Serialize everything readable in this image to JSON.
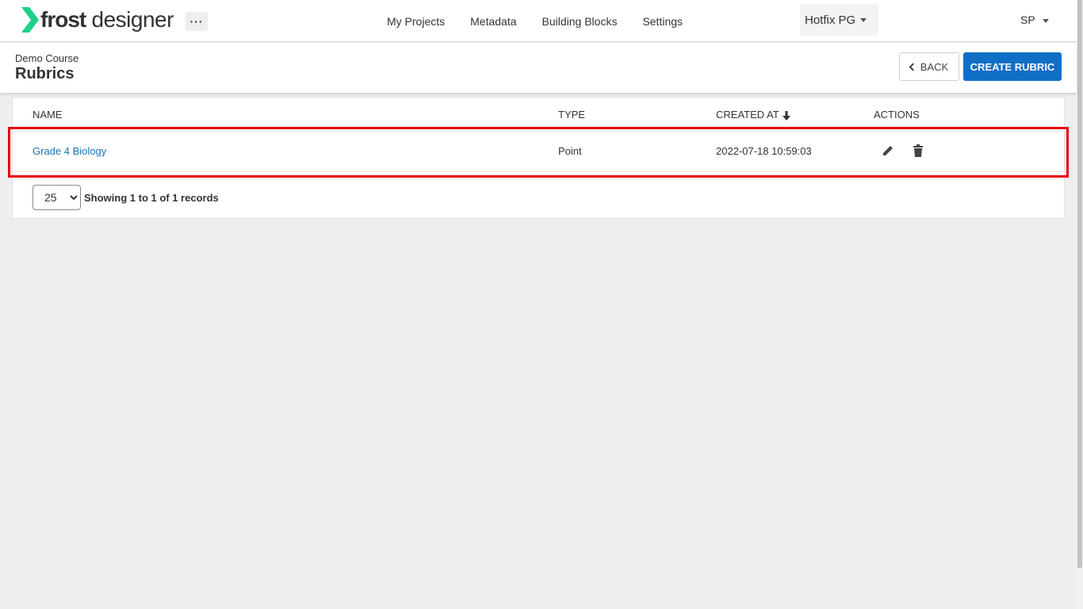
{
  "brand": {
    "name_bold": "frost",
    "name_light": "designer",
    "accent_color": "#1fd08a"
  },
  "topbar": {
    "more_label": "···",
    "nav": [
      "My Projects",
      "Metadata",
      "Building Blocks",
      "Settings"
    ],
    "tenant": "Hotfix PG",
    "user": "SP"
  },
  "page": {
    "course": "Demo Course",
    "title": "Rubrics",
    "back_label": "BACK",
    "create_label": "CREATE RUBRIC"
  },
  "table": {
    "columns": {
      "name": "NAME",
      "type": "TYPE",
      "created_at": "CREATED AT",
      "actions": "ACTIONS"
    },
    "sort": {
      "column": "created_at",
      "direction": "desc"
    },
    "rows": [
      {
        "name": "Grade 4 Biology",
        "type": "Point",
        "created_at": "2022-07-18 10:59:03"
      }
    ]
  },
  "pagination": {
    "page_size": "25",
    "page_size_options": [
      "25"
    ],
    "records_text": "Showing 1 to 1 of 1 records"
  },
  "colors": {
    "primary": "#0f6fc6",
    "link": "#1a73b8",
    "highlight": "#e8000b",
    "background": "#eeeeee"
  }
}
